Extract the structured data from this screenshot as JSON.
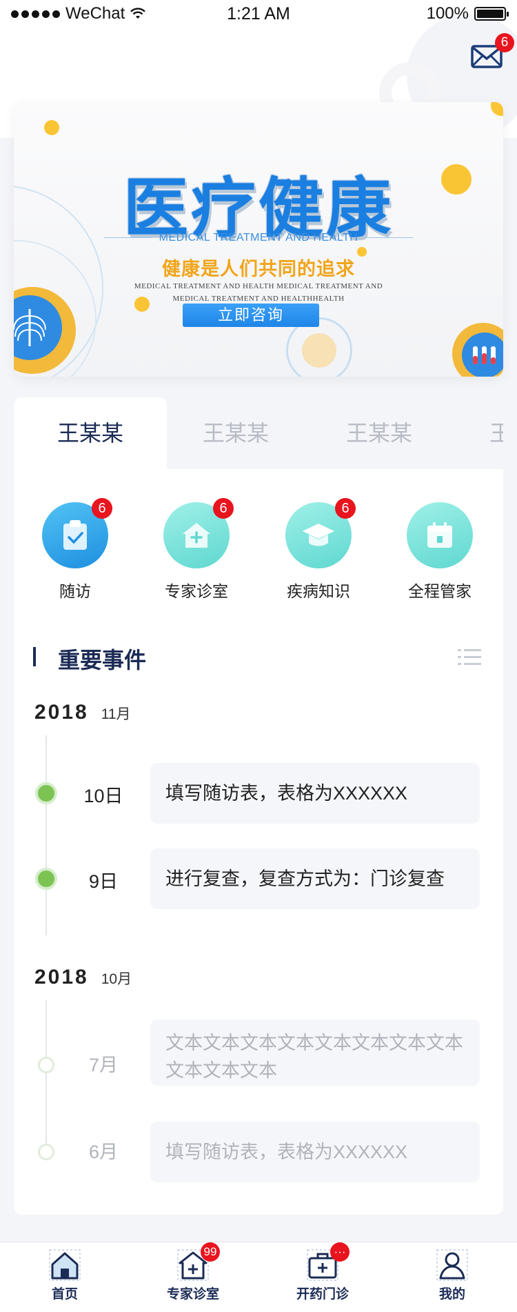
{
  "status_bar": {
    "carrier": "WeChat",
    "time": "1:21 AM",
    "battery": "100%"
  },
  "mail": {
    "icon": "mail-icon",
    "badge": "6"
  },
  "banner": {
    "title": "医疗健康",
    "subtitle_en": "MEDICAL TREATMENT AND HEALTH",
    "slogan": "健康是人们共同的追求",
    "small_text": "MEDICAL TREATMENT AND HEALTH MEDICAL TREATMENT AND MEDICAL TREATMENT AND HEALTHHEALTH",
    "button": "立即咨询"
  },
  "tabs": [
    {
      "label": "王某某",
      "active": true
    },
    {
      "label": "王某某",
      "active": false
    },
    {
      "label": "王某某",
      "active": false
    },
    {
      "label": "王",
      "active": false
    }
  ],
  "features": [
    {
      "label": "随访",
      "icon": "clipboard-check-icon",
      "badge": "6",
      "color": "#2aa3e8"
    },
    {
      "label": "专家诊室",
      "icon": "clinic-house-icon",
      "badge": "6",
      "color": "#6fe0d6"
    },
    {
      "label": "疾病知识",
      "icon": "graduation-cap-icon",
      "badge": "6",
      "color": "#6fe0d6"
    },
    {
      "label": "全程管家",
      "icon": "calendar-icon",
      "badge": "",
      "color": "#6fe0d6"
    }
  ],
  "events": {
    "title": "重要事件",
    "groups": [
      {
        "year": "2018",
        "month": "11月",
        "items": [
          {
            "day": "10日",
            "text": "填写随访表，表格为XXXXXX",
            "active": true
          },
          {
            "day": "9日",
            "text": "进行复查，复查方式为：门诊复查",
            "active": true
          }
        ]
      },
      {
        "year": "2018",
        "month": "10月",
        "items": [
          {
            "day": "7月",
            "text": "文本文本文本文本文本文本文本文本文本文本文本",
            "active": false
          },
          {
            "day": "6月",
            "text": "填写随访表，表格为XXXXXX",
            "active": false
          }
        ]
      }
    ]
  },
  "bottom_nav": [
    {
      "label": "首页",
      "icon": "home-icon",
      "badge": ""
    },
    {
      "label": "专家诊室",
      "icon": "clinic-plus-icon",
      "badge": "99"
    },
    {
      "label": "开药门诊",
      "icon": "medical-kit-icon",
      "badge": "···"
    },
    {
      "label": "我的",
      "icon": "user-icon",
      "badge": ""
    }
  ],
  "colors": {
    "primary": "#1b2b55",
    "accent_blue": "#1f86e8",
    "badge_red": "#e8141e",
    "timeline_green": "#7cc354",
    "banner_yellow": "#f0a51a"
  }
}
